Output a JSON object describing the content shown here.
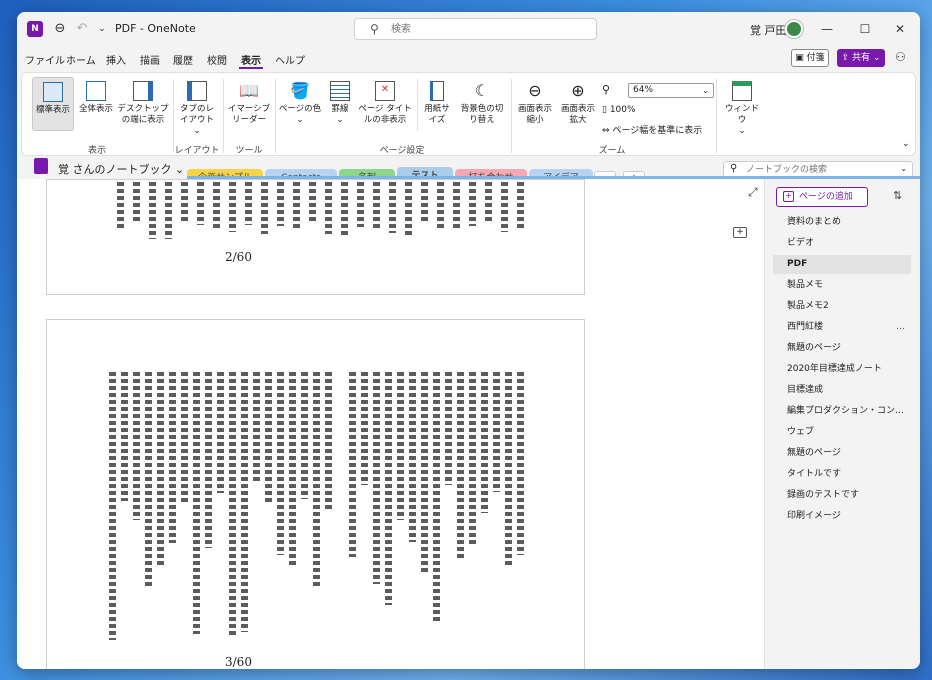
{
  "app": {
    "title": "PDF  -  OneNote",
    "icon_letter": "N",
    "search_placeholder": "検索",
    "user": "覚 戸田",
    "controls": {
      "minimize": "—",
      "maximize": "☐",
      "close": "✕"
    }
  },
  "menu": {
    "items": [
      "ファイル",
      "ホーム",
      "挿入",
      "描画",
      "履歴",
      "校閲",
      "表示",
      "ヘルプ"
    ],
    "active_index": 6,
    "sticky_label": "付箋",
    "share_label": "共有"
  },
  "ribbon": {
    "view_group": {
      "normal": "標準表示",
      "full": "全体表示",
      "dock": "デスクトップの端に表示",
      "label": "表示"
    },
    "layout_group": {
      "tab_layout": "タブのレイアウト",
      "label": "レイアウト"
    },
    "tools_group": {
      "reader": "イマーシブリーダー",
      "label": "ツール"
    },
    "page_setup_group": {
      "page_color": "ページの色",
      "rule_lines": "罫線",
      "hide_title": "ページ タイトルの非表示",
      "paper_size": "用紙サイズ",
      "bg_invert": "背景色の切り替え",
      "label": "ページ設定"
    },
    "zoom_group": {
      "zoom_out": "画面表示縮小",
      "zoom_in": "画面表示拡大",
      "zoom_value": "64%",
      "zoom_100": "100%",
      "fit_width": "ページ幅を基準に表示",
      "label": "ズーム"
    },
    "window_group": {
      "window": "ウィンドウ"
    }
  },
  "notebook": {
    "name": "覚 さんのノートブック",
    "sections": [
      {
        "label": "企画サンプル",
        "color": "#f7d34a"
      },
      {
        "label": "Contacts",
        "color": "#b7d3f2"
      },
      {
        "label": "名刺",
        "color": "#8ed68e"
      },
      {
        "label": "テスト",
        "color": "#a9cdea"
      },
      {
        "label": "打ち合わせ",
        "color": "#f3a8b4"
      },
      {
        "label": "アイデア",
        "color": "#b7d3f2"
      }
    ],
    "active_section_index": 3,
    "search_placeholder": "ノートブックの検索"
  },
  "content": {
    "page1_number": "2/60",
    "page2_number": "3/60"
  },
  "pages": {
    "add_label": "ページの追加",
    "items": [
      "資料のまとめ",
      "ビデオ",
      "PDF",
      "製品メモ",
      "製品メモ2",
      "西門紅楼",
      "無題のページ",
      "2020年目標達成ノート",
      "目標達成",
      "編集プロダクション・コンテンツ…",
      "ウェブ",
      "無題のページ",
      "タイトルです",
      "録画のテストです",
      "印刷イメージ"
    ],
    "selected_index": 2,
    "more_index": 5,
    "more_label": "…"
  }
}
